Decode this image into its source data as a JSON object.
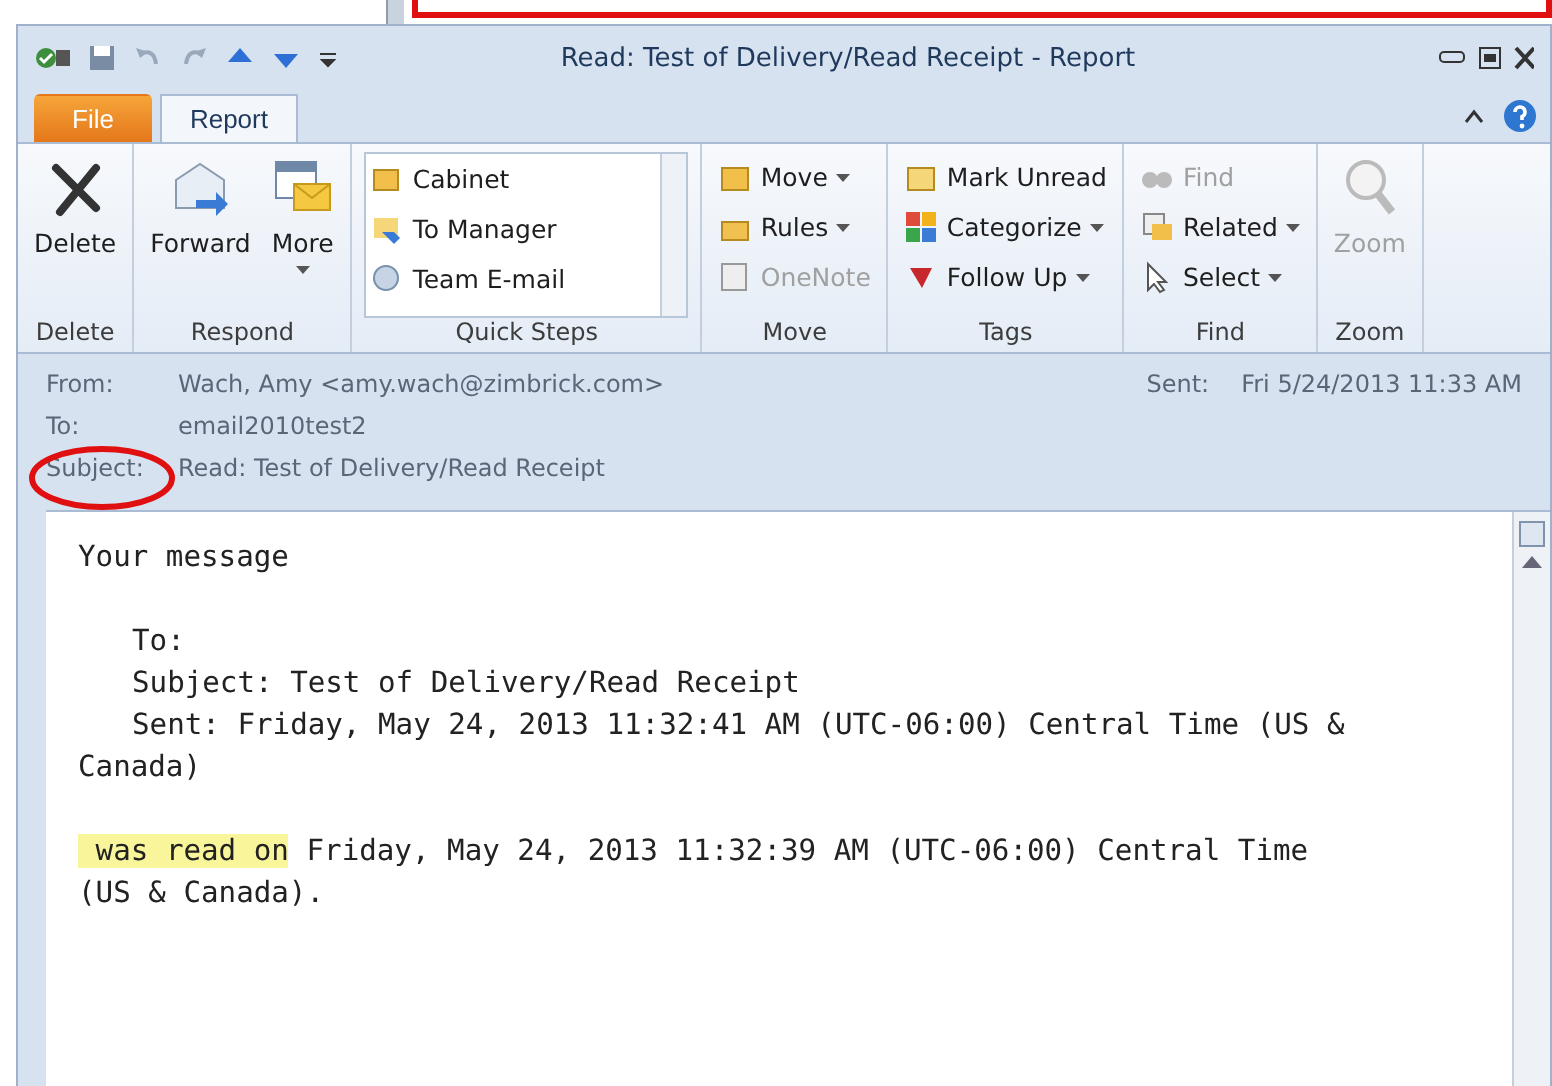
{
  "window": {
    "title": "Read: Test of Delivery/Read Receipt  -  Report"
  },
  "tabs": [
    {
      "label": "File",
      "kind": "file",
      "selected": false
    },
    {
      "label": "Report",
      "kind": "tab",
      "selected": true
    }
  ],
  "ribbon": {
    "groups": [
      {
        "label": "Delete",
        "kind": "large",
        "buttons": [
          {
            "label": "Delete",
            "dropdown": false,
            "disabled": false
          }
        ]
      },
      {
        "label": "Respond",
        "kind": "large",
        "buttons": [
          {
            "label": "Forward",
            "dropdown": false,
            "disabled": false
          },
          {
            "label": "More",
            "dropdown": true,
            "disabled": false
          }
        ]
      },
      {
        "label": "Quick Steps",
        "kind": "gallery",
        "buttons": [
          {
            "label": "Cabinet",
            "dropdown": false,
            "disabled": false
          },
          {
            "label": "To Manager",
            "dropdown": false,
            "disabled": false
          },
          {
            "label": "Team E-mail",
            "dropdown": false,
            "disabled": false
          }
        ]
      },
      {
        "label": "Move",
        "kind": "small",
        "buttons": [
          {
            "label": "Move",
            "dropdown": true,
            "disabled": false
          },
          {
            "label": "Rules",
            "dropdown": true,
            "disabled": false
          },
          {
            "label": "OneNote",
            "dropdown": false,
            "disabled": true
          }
        ]
      },
      {
        "label": "Tags",
        "kind": "small",
        "buttons": [
          {
            "label": "Mark Unread",
            "dropdown": false,
            "disabled": false
          },
          {
            "label": "Categorize",
            "dropdown": true,
            "disabled": false
          },
          {
            "label": "Follow Up",
            "dropdown": true,
            "disabled": false
          }
        ]
      },
      {
        "label": "Find",
        "kind": "small",
        "buttons": [
          {
            "label": "Find",
            "dropdown": false,
            "disabled": true
          },
          {
            "label": "Related",
            "dropdown": true,
            "disabled": false
          },
          {
            "label": "Select",
            "dropdown": true,
            "disabled": false
          }
        ]
      },
      {
        "label": "Zoom",
        "kind": "large",
        "buttons": [
          {
            "label": "Zoom",
            "dropdown": false,
            "disabled": true
          }
        ]
      }
    ]
  },
  "header": {
    "fields": [
      {
        "label": "From:",
        "value": "Wach, Amy <amy.wach@zimbrick.com>"
      },
      {
        "label": "To:",
        "value": "email2010test2"
      },
      {
        "label": "Subject:",
        "value": "Read: Test of Delivery/Read Receipt"
      }
    ],
    "sent": {
      "label": "Sent:",
      "value": "Fri 5/24/2013 11:33 AM"
    }
  },
  "body": {
    "paragraphs": [
      {
        "lines": [
          {
            "text": "Your message",
            "indented": false
          }
        ]
      },
      {
        "lines": [
          {
            "text": "To:",
            "indented": true
          },
          {
            "text": "Subject: Test of Delivery/Read Receipt",
            "indented": true
          },
          {
            "text": "Sent: Friday, May 24, 2013 11:32:41 AM (UTC-06:00) Central Time (US &",
            "indented": true
          },
          {
            "text": "Canada)",
            "indented": false
          }
        ]
      },
      {
        "lines": [
          {
            "highlight": "was read on",
            "text": "Friday, May 24, 2013 11:32:39 AM (UTC-06:00) Central Time",
            "indented": false
          },
          {
            "text": "(US & Canada).",
            "indented": false
          }
        ]
      }
    ]
  }
}
